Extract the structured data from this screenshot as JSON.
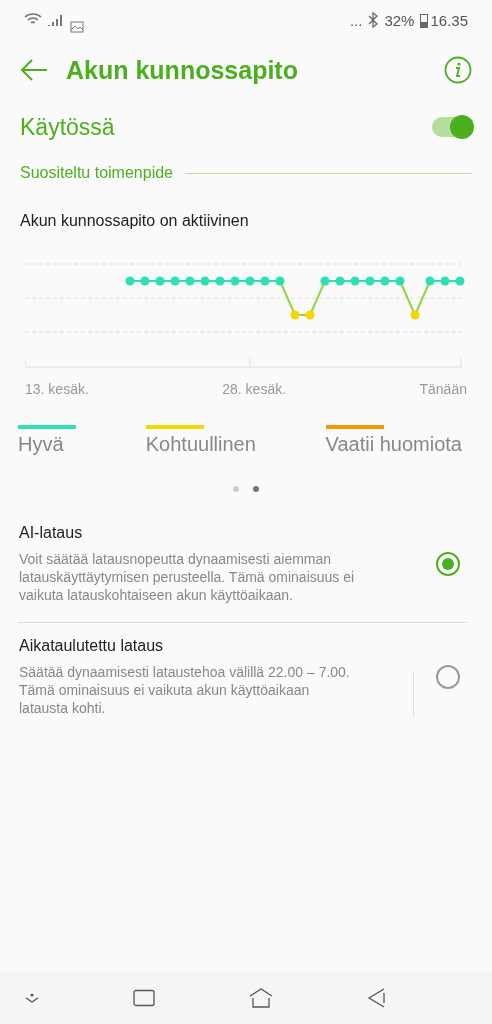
{
  "status_bar": {
    "dots": "...",
    "battery": "32%",
    "time": "16.35"
  },
  "header": {
    "title": "Akun kunnossapito"
  },
  "toggle": {
    "label": "Käytössä",
    "on": true
  },
  "section": {
    "title": "Suositeltu toimenpide"
  },
  "chart": {
    "title": "Akun kunnossapito on aktiivinen",
    "x_labels": [
      "13. kesäk.",
      "28. kesäk.",
      "Tänään"
    ]
  },
  "legend": [
    {
      "label": "Hyvä",
      "color": "#2de0b5"
    },
    {
      "label": "Kohtuullinen",
      "color": "#f5d800"
    },
    {
      "label": "Vaatii huomiota",
      "color": "#f59a00"
    }
  ],
  "pager": [
    {
      "selected": false
    },
    {
      "selected": true
    }
  ],
  "options": [
    {
      "title": "AI-lataus",
      "description": "Voit säätää latausnopeutta dynaamisesti aiemman latauskäyttäytymisen perusteella. Tämä ominaisuus ei vaikuta latauskohtaiseen akun käyttöaikaan.",
      "selected": true,
      "divider": false
    },
    {
      "title": "Aikataulutettu lataus",
      "description": "Säätää dynaamisesti lataustehoa välillä 22.00 – 7.00. Tämä ominaisuus ei vaikuta akun käyttöaikaan latausta kohti.",
      "selected": false,
      "divider": true
    }
  ]
}
